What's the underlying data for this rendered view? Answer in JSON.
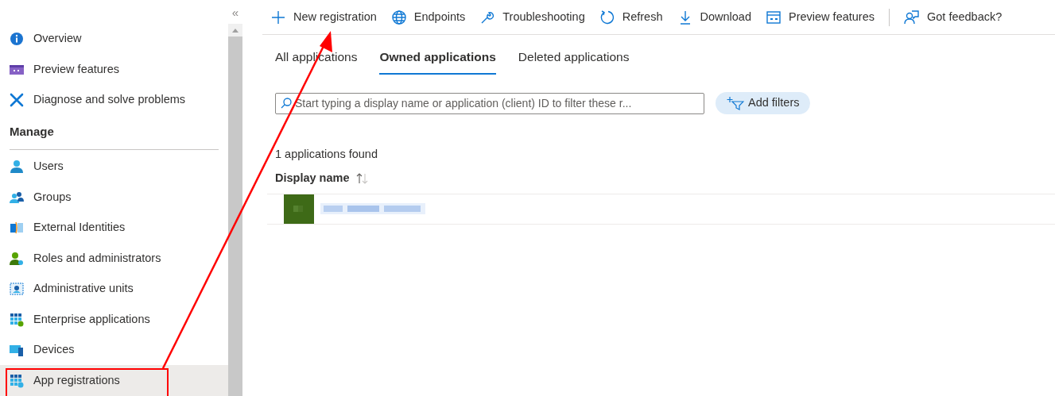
{
  "sidebar": {
    "collapse_glyph": "«",
    "top_items": [
      {
        "label": "Overview",
        "selected": false
      },
      {
        "label": "Preview features",
        "selected": false
      },
      {
        "label": "Diagnose and solve problems",
        "selected": false
      }
    ],
    "section": {
      "title": "Manage",
      "items": [
        {
          "label": "Users",
          "selected": false
        },
        {
          "label": "Groups",
          "selected": false
        },
        {
          "label": "External Identities",
          "selected": false
        },
        {
          "label": "Roles and administrators",
          "selected": false
        },
        {
          "label": "Administrative units",
          "selected": false
        },
        {
          "label": "Enterprise applications",
          "selected": false
        },
        {
          "label": "Devices",
          "selected": false
        },
        {
          "label": "App registrations",
          "selected": true
        }
      ]
    }
  },
  "toolbar": [
    {
      "label": "New registration"
    },
    {
      "label": "Endpoints"
    },
    {
      "label": "Troubleshooting"
    },
    {
      "label": "Refresh"
    },
    {
      "label": "Download"
    },
    {
      "label": "Preview features"
    },
    {
      "label": "Got feedback?"
    }
  ],
  "tabs": [
    {
      "label": "All applications",
      "selected": false
    },
    {
      "label": "Owned applications",
      "selected": true
    },
    {
      "label": "Deleted applications",
      "selected": false
    }
  ],
  "search": {
    "placeholder": "Start typing a display name or application (client) ID to filter these r..."
  },
  "add_filters": "Add filters",
  "count": "1 applications found",
  "table": {
    "column": "Display name"
  }
}
